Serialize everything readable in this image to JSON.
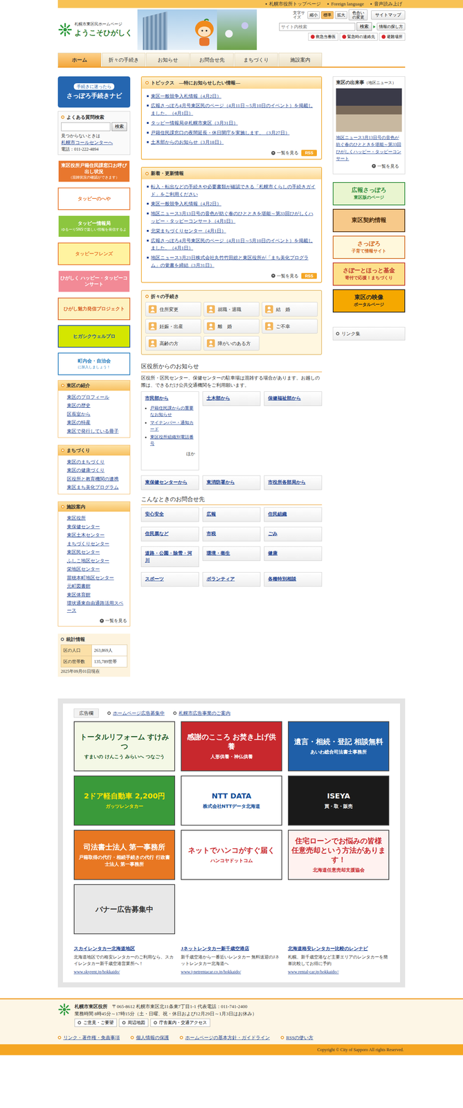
{
  "top_links": [
    "札幌市役所トップページ",
    "Foreign language",
    "音声読み上げ"
  ],
  "header": {
    "logo_small": "札幌市東区民ホームページ",
    "logo_main": "ようこそひがしく",
    "size_label": "文字サイズ",
    "size_buttons": [
      {
        "label": "縮小",
        "selected": false
      },
      {
        "label": "標準",
        "selected": true
      },
      {
        "label": "拡大",
        "selected": false
      }
    ],
    "color_button": "色合いの変更",
    "sitemap": "サイトマップ",
    "search_placeholder": "サイト内検索",
    "search_button": "検索",
    "search_help": "情報の探し方",
    "emergency": [
      "救急当番医",
      "緊急時の連絡先",
      "避難場所"
    ]
  },
  "nav": [
    {
      "label": "ホーム",
      "selected": true
    },
    {
      "label": "折々の手続き",
      "selected": false
    },
    {
      "label": "お知らせ",
      "selected": false
    },
    {
      "label": "お問合せ先",
      "selected": false
    },
    {
      "label": "まちづくり",
      "selected": false
    },
    {
      "label": "施設案内",
      "selected": false
    }
  ],
  "left": {
    "navi": {
      "small": "手続きに迷ったら",
      "main": "さっぽろ手続きナビ"
    },
    "faq": {
      "title": "よくある質問検索",
      "button": "検索",
      "note": "見つからないときは",
      "link": "札幌市コールセンターへ",
      "phone": "電話：011-222-4894"
    },
    "banners": [
      {
        "label": "東区役所戸籍住民課窓口お呼び出し状況",
        "sub": "（混雑状況の確認ができます）",
        "color": "#e8772e",
        "text_color": "#ffffff"
      },
      {
        "label": "タッピーのへや",
        "sub": "",
        "color": "#ffffff",
        "text_color": "#e8772e"
      },
      {
        "label": "タッピー情報局",
        "sub": "ゆるーりSNSで楽しい情報を発信するよ",
        "color": "#8cc63f",
        "text_color": "#ffffff"
      },
      {
        "label": "タッピーフレンズ",
        "sub": "",
        "color": "#fff3a0",
        "text_color": "#e8772e"
      },
      {
        "label": "ひがしく ハッピー・タッピーコンサート",
        "sub": "",
        "color": "#f28a96",
        "text_color": "#ffffff"
      },
      {
        "label": "ひがし魅力発信プロジェクト",
        "sub": "",
        "color": "#fdf2c0",
        "text_color": "#d9642b"
      },
      {
        "label": "ヒガシクウェルプロ",
        "sub": "",
        "color": "#d4e600",
        "text_color": "#1c4fa0"
      },
      {
        "label": "町内会・自治会",
        "sub": "に加入しましょう！",
        "color": "#ffffff",
        "text_color": "#2a7fc0"
      }
    ],
    "menus": [
      {
        "title": "東区の紹介",
        "items": [
          "東区のプロフィール",
          "東区の歴史",
          "区長室から",
          "東区の特産",
          "東区で発行している冊子"
        ],
        "more": ""
      },
      {
        "title": "まちづくり",
        "items": [
          "東区のまちづくり",
          "東区の健康づくり",
          "区役所と教育機関の連携",
          "東区まち美化プログラム"
        ],
        "more": ""
      },
      {
        "title": "施設案内",
        "items": [
          "東区役所",
          "東保健センター",
          "東区土木センター",
          "まちづくりセンター",
          "東区民センター",
          "ふしこ地区センター",
          "栄地区センター",
          "苗穂本町地区センター",
          "元町図書館",
          "東区体育館",
          "環状通東自由通路活用スペース"
        ],
        "more": "一覧を見る"
      }
    ],
    "stats": {
      "title": "統計情報",
      "rows": [
        {
          "label": "区の人口",
          "value": "263,869人"
        },
        {
          "label": "区の世帯数",
          "value": "135,789世帯"
        }
      ],
      "note": "2025年09月01日現在"
    }
  },
  "topics": {
    "title": "トピックス　―特にお知らせしたい情報―",
    "items": [
      "東区一般競争入札情報（4月2日）",
      "広報さっぽろ4月号東区民のページ（4月11日～5月10日のイベント）を掲載しました。（4月1日）",
      "タッピー情報局＠札幌市東区（3月31日）",
      "戸籍住民課窓口の夜間延長・休日開庁を実施します。（3月27日）",
      "土木部からのお知らせ（3月18日）"
    ],
    "more": "一覧を見る",
    "rss": "RSS"
  },
  "updates": {
    "title": "新着・更新情報",
    "items": [
      "転入・転出などの手続きや必要書類が確認できる「札幌市くらしの手続きガイド」をご利用ください",
      "東区一般競争入札情報（4月2日）",
      "地区ニュース3月13日号の音色が紡ぐ春のひとときを堪能～第33回ひがしくハッピー・タッピーコンサート（4月1日）",
      "北栄まちづくりセンター（4月1日）",
      "広報さっぽろ4月号東区民のページ（4月11日～5月10日のイベント）を掲載しました。（4月1日）",
      "地区ニュース3月23日株式会社丸竹竹田総と東区役所が「まち美化プログラム」の覚書を締結（3月31日）"
    ],
    "more": "一覧を見る",
    "rss": "RSS"
  },
  "procedures": {
    "title": "折々の手続き",
    "items": [
      "住所変更",
      "就職・退職",
      "結　婚",
      "妊娠・出産",
      "離　婚",
      "ご不幸",
      "高齢の方",
      "障がいのある方"
    ]
  },
  "notices": {
    "title": "区役所からのお知らせ",
    "text": "区役所・区民センター、保健センターの駐車場は混雑する場合があります。お越しの際は、できるだけ公共交通機関をご利用願います。",
    "cards": [
      {
        "label": "市民部から",
        "items": [
          "戸籍住民課からの重要なお知らせ",
          "マイナンバー・通知カード",
          "東区役所組織別電話番号"
        ],
        "extra": "ほか"
      },
      {
        "label": "土木部から",
        "items": [],
        "extra": ""
      },
      {
        "label": "保健福祉部から",
        "items": [],
        "extra": ""
      },
      {
        "label": "東保健センターから",
        "items": [],
        "extra": ""
      },
      {
        "label": "東消防署から",
        "items": [],
        "extra": ""
      },
      {
        "label": "市役所各部局から",
        "items": [],
        "extra": ""
      }
    ]
  },
  "contacts": {
    "title": "こんなときのお問合せ先",
    "items": [
      "安心安全",
      "広報",
      "住民組織",
      "住民票など",
      "市税",
      "ごみ",
      "道路・公園・除雪・河川",
      "環境・衛生",
      "健康",
      "スポーツ",
      "ボランティア",
      "各種特別相談"
    ]
  },
  "right": {
    "event": {
      "title": "東区の出来事",
      "title_sub": "（地区ニュース）",
      "caption": "地区ニュース3月13日号の音色が紡ぐ春のひとときを堪能～第33回ひがしくハッピー・タッピーコンサート",
      "more": "一覧を見る"
    },
    "banners": [
      {
        "label": "広報さっぽろ",
        "sub": "東区版のページ",
        "color": "#e9f5d0",
        "text_color": "#2e8b3a"
      },
      {
        "label": "東区契約情報",
        "sub": "",
        "color": "#f7c98a",
        "text_color": "#4a2a0a"
      },
      {
        "label": "さっぽろ",
        "sub": "子育て情報サイト",
        "color": "#fff8dc",
        "text_color": "#d2691e"
      },
      {
        "label": "さぽーとほっと基金",
        "sub": "寄付で応援！まちづくり",
        "color": "#fde08a",
        "text_color": "#c0392b"
      },
      {
        "label": "東区の映像",
        "sub": "ポータルページ",
        "color": "#f5a800",
        "text_color": "#222222"
      }
    ],
    "links": "リンク集"
  },
  "ads": {
    "title": "広告欄",
    "links": [
      "ホームページ広告募集中",
      "札幌市広告事業のご案内"
    ],
    "banners": [
      {
        "label": "トータルリフォーム すけみつ",
        "sub": "すまいの けんこう みらいへ つなごう",
        "color": "#f4f8e6",
        "text_color": "#1e5a2a"
      },
      {
        "label": "感謝のこころ お焚き上げ供養",
        "sub": "人形供養・神仏供養",
        "color": "#c8282d",
        "text_color": "#ffffff"
      },
      {
        "label": "遺言・相続・登記 相談無料",
        "sub": "あいわ総合司法書士事務所",
        "color": "#1f5fa8",
        "text_color": "#ffffff"
      },
      {
        "label": "2ドア軽自動車 2,200円",
        "sub": "ガッツレンタカー",
        "color": "#3a9a3a",
        "text_color": "#ffe600"
      },
      {
        "label": "NTT DATA",
        "sub": "株式会社NTTデータ北海道",
        "color": "#ffffff",
        "text_color": "#0f4c97"
      },
      {
        "label": "ISEYA",
        "sub": "買・取・販売",
        "color": "#1a1a1a",
        "text_color": "#ffffff"
      },
      {
        "label": "司法書士法人 第一事務所",
        "sub": "戸籍取得の代行・相続手続きの代行 行政書士法人 第一事務所",
        "color": "#e87722",
        "text_color": "#ffffff"
      },
      {
        "label": "ネットでハンコがすぐ届く",
        "sub": "ハンコヤドットコム",
        "color": "#ffffff",
        "text_color": "#c8282d"
      },
      {
        "label": "住宅ローンでお悩みの皆様 任意売却という方法があります！",
        "sub": "北海道任意売却支援協会",
        "color": "#fff2f0",
        "text_color": "#c8282d"
      },
      {
        "label": "バナー広告募集中",
        "sub": "",
        "color": "#e8e8e8",
        "text_color": "#333333"
      }
    ],
    "text_ads": [
      {
        "title": "スカイレンタカー北海道地区",
        "body": "北海道地区での格安レンタカーのご利用なら、スカイレンタカー新千歳空港営業所へ！",
        "url": "www.skyrent.jp/hokkaido/"
      },
      {
        "title": "Jネットレンタカー新千歳空港店",
        "body": "新千歳空港から一番近いレンタカー 無料送迎のJネットレンタカー北海道へ",
        "url": "www.j-netrentacar.co.jp/hokkaido/"
      },
      {
        "title": "北海道格安レンタカー比較のレンナビ",
        "body": "札幌、新千歳空港など主要エリアのレンタカーを簡単比較してお得に予約",
        "url": "www.rental-car.jp/hokkaido//"
      }
    ]
  },
  "footer": {
    "name": "札幌市東区役所",
    "address": "〒065-8612 札幌市東区北11条東7丁目1-1 代表電話：011-741-2400",
    "hours": "業務時間 8時45分～17時15分（土・日曜、祝・休日および12月29日～1月3日はお休み）",
    "buttons": [
      "ご意見・ご要望",
      "周辺地図",
      "庁舎案内・交通アクセス"
    ],
    "links": [
      "リンク・著作権・免責事項",
      "個人情報の保護",
      "ホームページの基本方針・ガイドライン",
      "RSSの使い方"
    ],
    "copyright": "Copyright © City of Sapporo All rights Reserved."
  }
}
